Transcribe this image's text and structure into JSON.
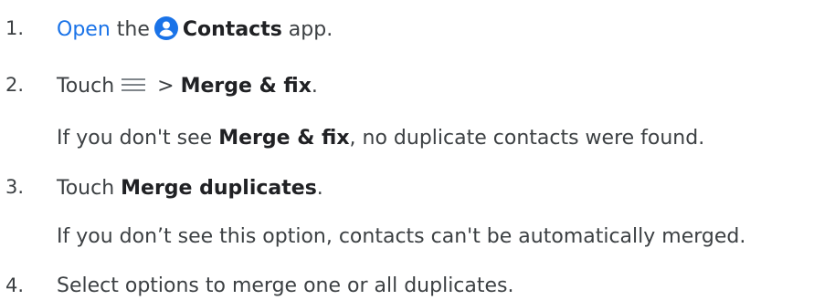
{
  "colors": {
    "link": "#1a73e8",
    "text": "#3c4043",
    "contacts_icon_bg": "#1a73e8"
  },
  "icons": {
    "contacts": "contacts-app-icon",
    "menu": "menu-icon"
  },
  "steps": [
    {
      "number": "1.",
      "link": "Open",
      "text_a": " the",
      "app_name": "Contacts",
      "text_b": " app."
    },
    {
      "number": "2.",
      "text_a": "Touch",
      "sep": " > ",
      "bold": "Merge & fix",
      "text_b": ".",
      "note_a": "If you don't see ",
      "note_bold": "Merge & fix",
      "note_b": ", no duplicate contacts were found."
    },
    {
      "number": "3.",
      "text_a": "Touch ",
      "bold": "Merge duplicates",
      "text_b": ".",
      "note": "If you don’t see this option, contacts can't be automatically merged."
    },
    {
      "number": "4.",
      "text": "Select options to merge one or all duplicates."
    }
  ]
}
